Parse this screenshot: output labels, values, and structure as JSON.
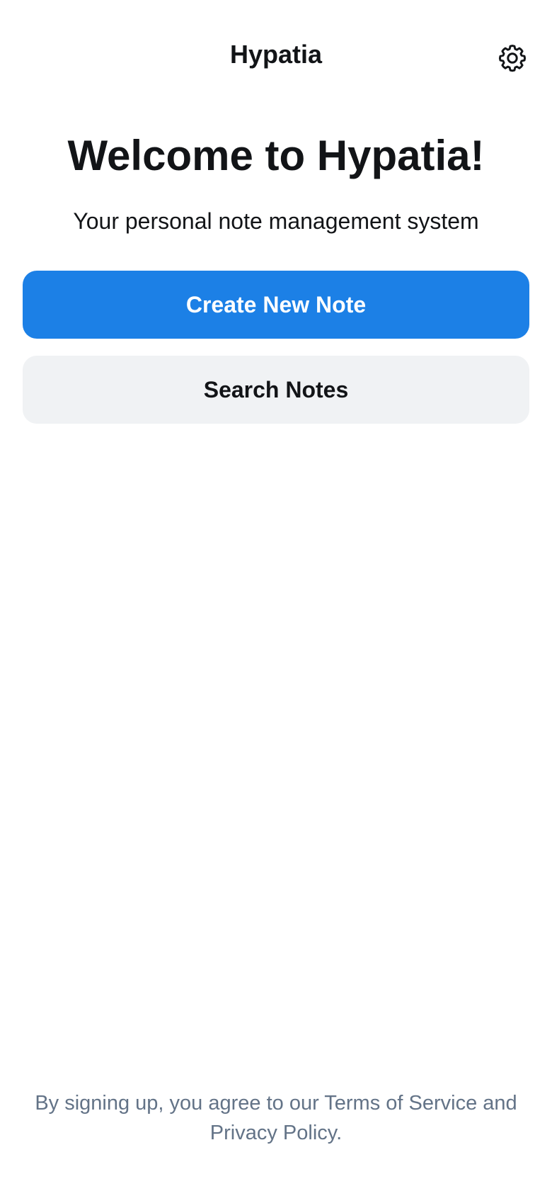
{
  "header": {
    "title": "Hypatia",
    "settings_icon": "gear-icon"
  },
  "main": {
    "welcome_title": "Welcome to Hypatia!",
    "subtitle": "Your personal note management system",
    "create_button_label": "Create New Note",
    "search_button_label": "Search Notes"
  },
  "footer": {
    "legal_text": "By signing up, you agree to our Terms of Service and Privacy Policy."
  },
  "colors": {
    "primary": "#1c80e6",
    "secondary_button": "#f0f2f4",
    "text": "#121417",
    "muted_text": "#637387"
  }
}
